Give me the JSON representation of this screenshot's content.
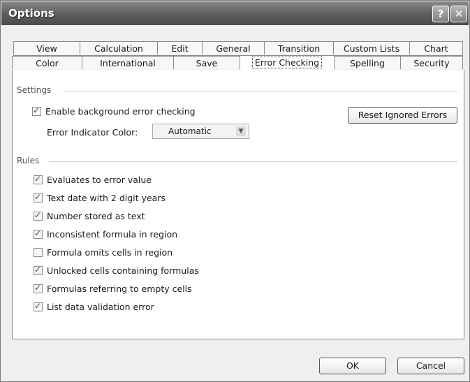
{
  "window": {
    "title": "Options",
    "help_glyph": "?",
    "close_glyph": "✕"
  },
  "tabs_row1": [
    "View",
    "Calculation",
    "Edit",
    "General",
    "Transition",
    "Custom Lists",
    "Chart"
  ],
  "tabs_row2": [
    "Color",
    "International",
    "Save",
    "Error Checking",
    "Spelling",
    "Security"
  ],
  "active_tab": "Error Checking",
  "settings": {
    "section_label": "Settings",
    "enable_background": {
      "label": "Enable background error checking",
      "checked": true
    },
    "indicator_color_label": "Error Indicator Color:",
    "indicator_color_value": "Automatic",
    "reset_button": "Reset Ignored Errors"
  },
  "rules": {
    "section_label": "Rules",
    "items": [
      {
        "label": "Evaluates to error value",
        "checked": true
      },
      {
        "label": "Text date with 2 digit years",
        "checked": true
      },
      {
        "label": "Number stored as text",
        "checked": true
      },
      {
        "label": "Inconsistent formula in region",
        "checked": true
      },
      {
        "label": "Formula omits cells in region",
        "checked": false
      },
      {
        "label": "Unlocked cells containing formulas",
        "checked": true
      },
      {
        "label": "Formulas referring to empty cells",
        "checked": true
      },
      {
        "label": "List data validation error",
        "checked": true
      }
    ]
  },
  "footer": {
    "ok": "OK",
    "cancel": "Cancel"
  }
}
